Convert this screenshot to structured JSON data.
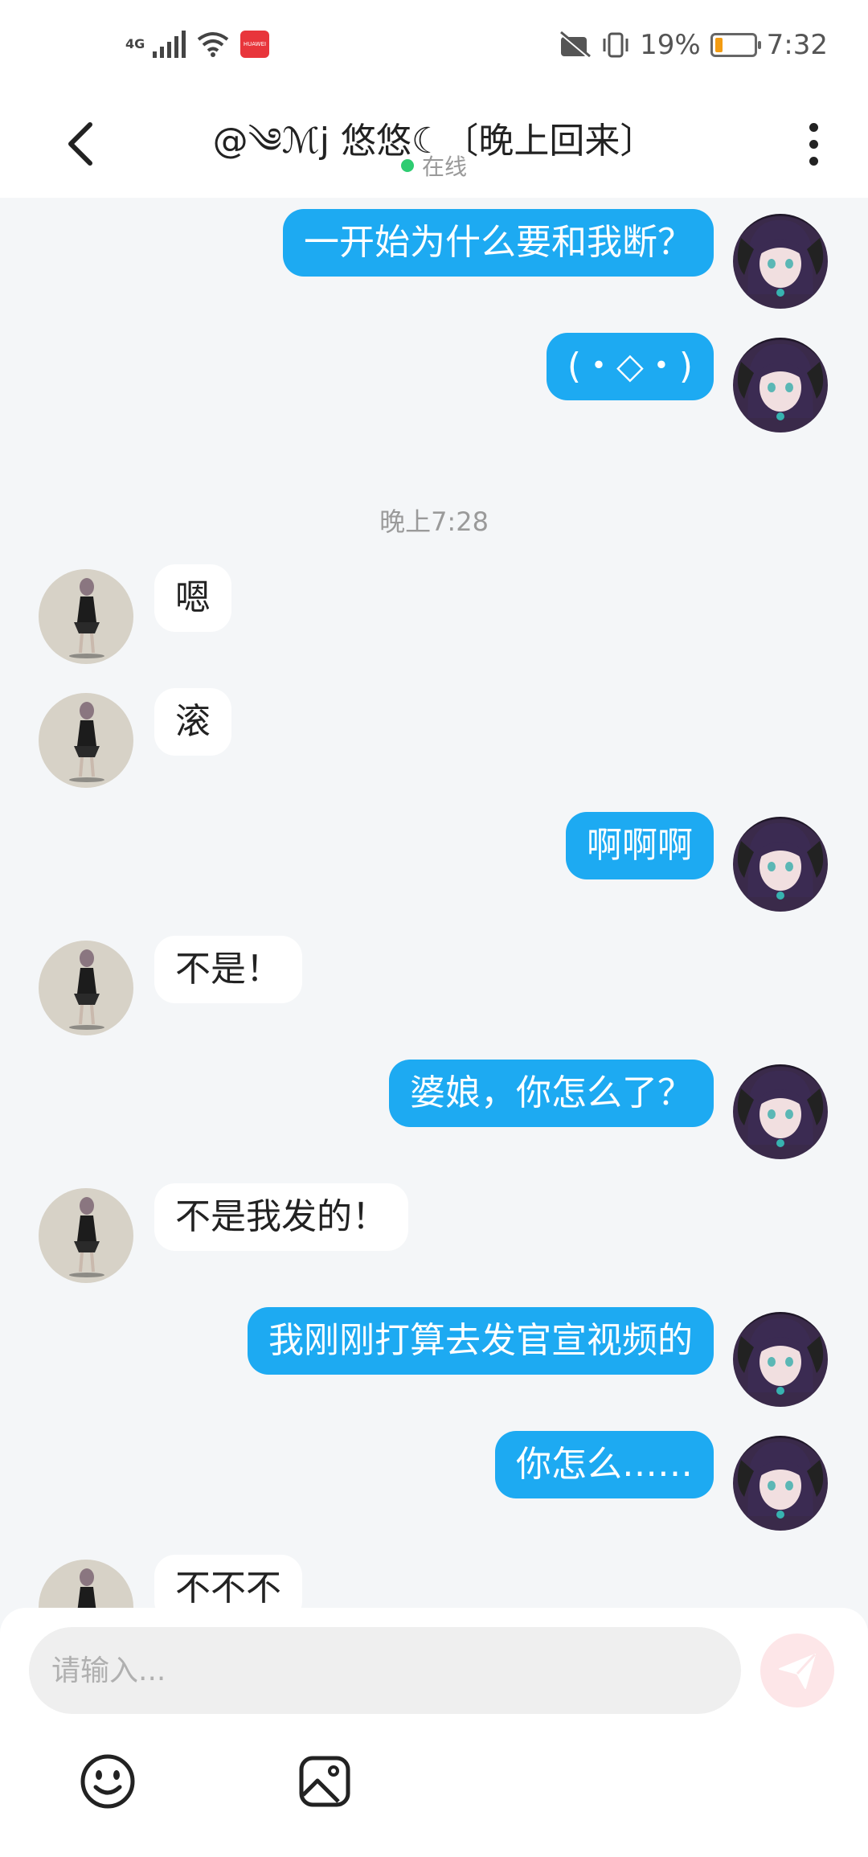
{
  "status_bar": {
    "network": "4G",
    "battery_percent": "19%",
    "battery_level": 0.19,
    "time": "7:32",
    "app_badge": "HUAWEI"
  },
  "header": {
    "title": "@༄ℳj 悠悠☾〔晚上回来〕",
    "status": "在线",
    "status_color": "#2ecc71"
  },
  "messages": [
    {
      "side": "me",
      "text": "一开始为什么要和我断？"
    },
    {
      "side": "me",
      "text": "(・◇・)"
    },
    {
      "side": "time",
      "text": "晚上7:28"
    },
    {
      "side": "them",
      "text": "嗯"
    },
    {
      "side": "them",
      "text": "滚"
    },
    {
      "side": "me",
      "text": "啊啊啊"
    },
    {
      "side": "them",
      "text": "不是！"
    },
    {
      "side": "me",
      "text": "婆娘，你怎么了？"
    },
    {
      "side": "them",
      "text": "不是我发的！"
    },
    {
      "side": "me",
      "text": "我刚刚打算去发官宣视频的"
    },
    {
      "side": "me",
      "text": "你怎么……"
    },
    {
      "side": "them",
      "text": "不不不"
    }
  ],
  "input": {
    "placeholder": "请输入..."
  },
  "colors": {
    "my_bubble": "#1daaf2",
    "their_bubble": "#ffffff",
    "background": "#f4f6f8"
  },
  "icons": {
    "back": "chevron-left-icon",
    "more": "more-vertical-icon",
    "send": "send-icon",
    "emoji": "emoji-icon",
    "image": "image-icon"
  }
}
